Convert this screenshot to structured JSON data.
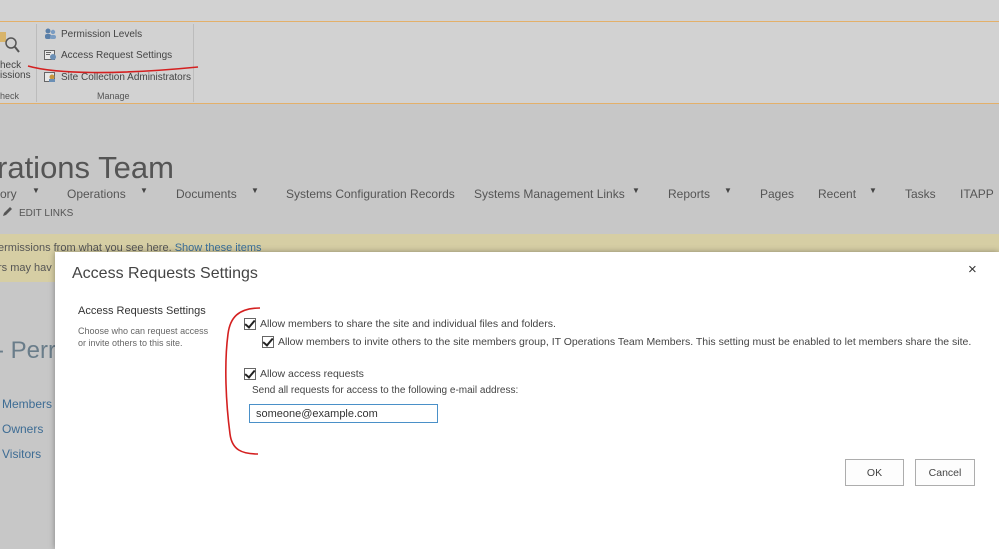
{
  "ribbon": {
    "check_label_line1": "heck",
    "check_label_line2": "issions",
    "check_group": "heck",
    "manage_group": "Manage",
    "items": [
      {
        "label": "Permission Levels",
        "icon": "users-icon"
      },
      {
        "label": "Access Request Settings",
        "icon": "settings-icon"
      },
      {
        "label": "Site Collection Administrators",
        "icon": "admin-icon"
      }
    ]
  },
  "site": {
    "title": "rations Team",
    "nav": [
      "ory",
      "Operations",
      "Documents",
      "Systems Configuration Records",
      "Systems Management Links",
      "Reports",
      "Pages",
      "Recent",
      "Tasks",
      "ITAPP"
    ],
    "edit_links": "EDIT LINKS"
  },
  "warning": {
    "line1_text": "ermissions from what you see here.",
    "line1_link": "Show these items",
    "line2_text": "rs may hav"
  },
  "permissions": {
    "title": "- Perr",
    "groups": [
      "Members",
      "Owners",
      "Visitors"
    ]
  },
  "dialog": {
    "title": "Access Requests Settings",
    "close": "×",
    "section_title": "Access Requests Settings",
    "section_desc": "Choose who can request access or invite others to this site.",
    "allow_share": "Allow members to share the site and individual files and folders.",
    "allow_invite": "Allow members to invite others to the site members group, IT Operations Team Members. This setting must be enabled to let members share the site.",
    "allow_requests": "Allow access requests",
    "email_label": "Send all requests for access to the following e-mail address:",
    "email_value": "someone@example.com",
    "ok": "OK",
    "cancel": "Cancel"
  },
  "colors": {
    "annotation": "#d42020",
    "link": "#3b6f99",
    "input_border": "#4a90c8",
    "warning_bg": "#d6cea4"
  }
}
